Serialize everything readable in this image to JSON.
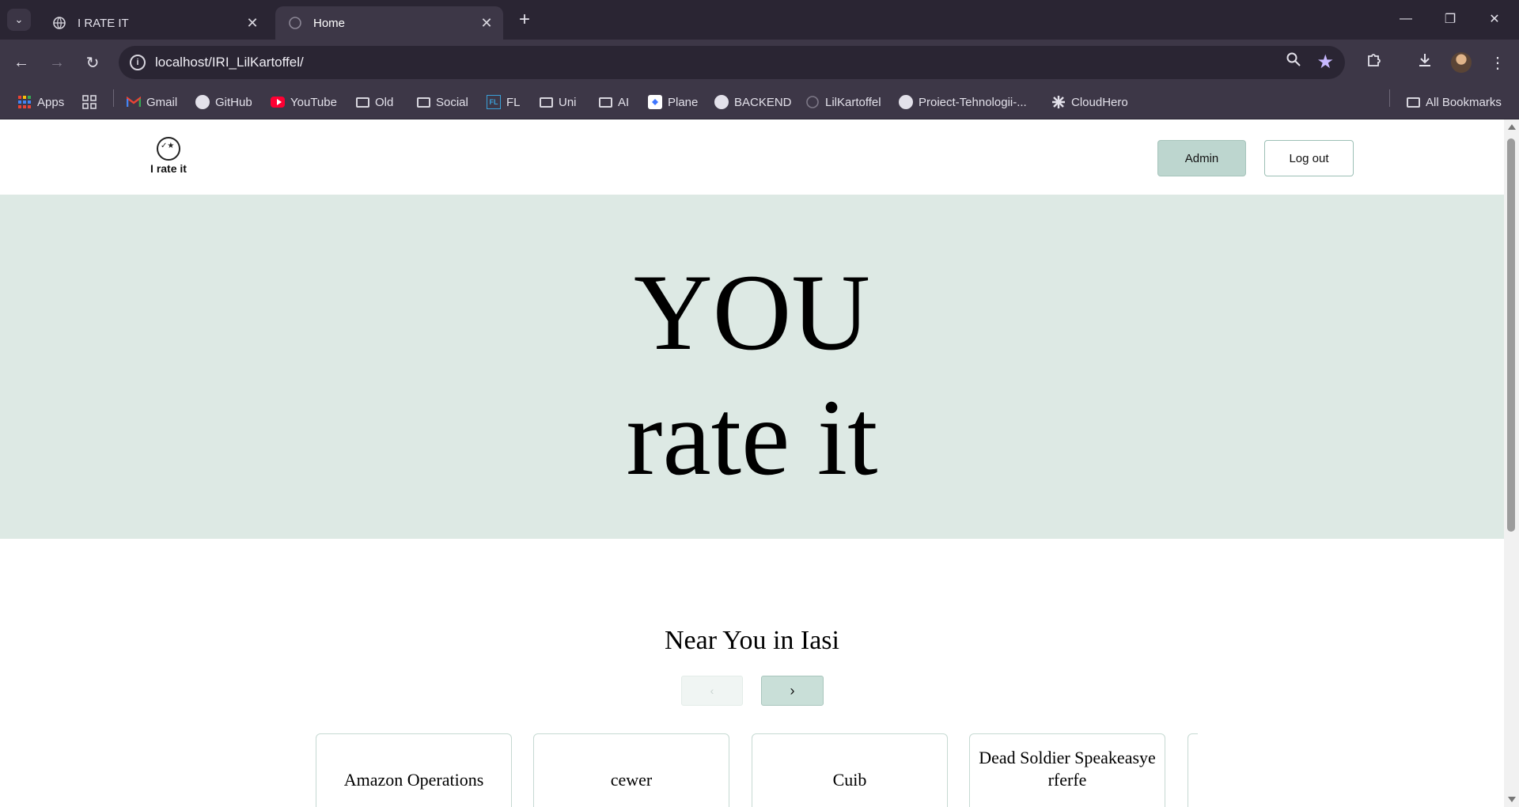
{
  "browser": {
    "tabs": [
      {
        "title": "I RATE IT",
        "active": false
      },
      {
        "title": "Home",
        "active": true
      }
    ],
    "url": "localhost/IRI_LilKartoffel/",
    "bookmarks": [
      {
        "label": "Apps",
        "icon": "apps-grid-icon"
      },
      {
        "label": "",
        "icon": "tab-groups-icon"
      },
      {
        "label": "Gmail",
        "icon": "gmail-icon"
      },
      {
        "label": "GitHub",
        "icon": "github-icon"
      },
      {
        "label": "YouTube",
        "icon": "youtube-icon"
      },
      {
        "label": "Old",
        "icon": "folder-icon"
      },
      {
        "label": "Social",
        "icon": "folder-icon"
      },
      {
        "label": "FL",
        "icon": "fl-icon"
      },
      {
        "label": "Uni",
        "icon": "folder-icon"
      },
      {
        "label": "AI",
        "icon": "folder-icon"
      },
      {
        "label": "Plane",
        "icon": "plane-icon"
      },
      {
        "label": "BACKEND",
        "icon": "github-icon"
      },
      {
        "label": "LilKartoffel",
        "icon": "globe-icon"
      },
      {
        "label": "Proiect-Tehnologii-...",
        "icon": "github-icon"
      },
      {
        "label": "CloudHero",
        "icon": "cloudhero-icon"
      }
    ],
    "all_bookmarks": "All Bookmarks"
  },
  "site": {
    "logo_text": "I rate it",
    "nav": {
      "admin": "Admin",
      "logout": "Log out"
    },
    "hero": {
      "line1": "YOU",
      "line2": "rate it"
    },
    "section_title": "Near You in Iasi",
    "pager": {
      "prev": "‹",
      "next": "›"
    },
    "cards": [
      {
        "name": "Amazon Operations"
      },
      {
        "name": "cewer"
      },
      {
        "name": "Cuib"
      },
      {
        "name": "Dead Soldier Speakeasye rferfe"
      },
      {
        "name": ""
      }
    ]
  },
  "colors": {
    "hero_bg": "#dde9e4",
    "admin_btn": "#bdd6cf",
    "chrome_dark": "#2a2533",
    "chrome_mid": "#3d3747"
  }
}
